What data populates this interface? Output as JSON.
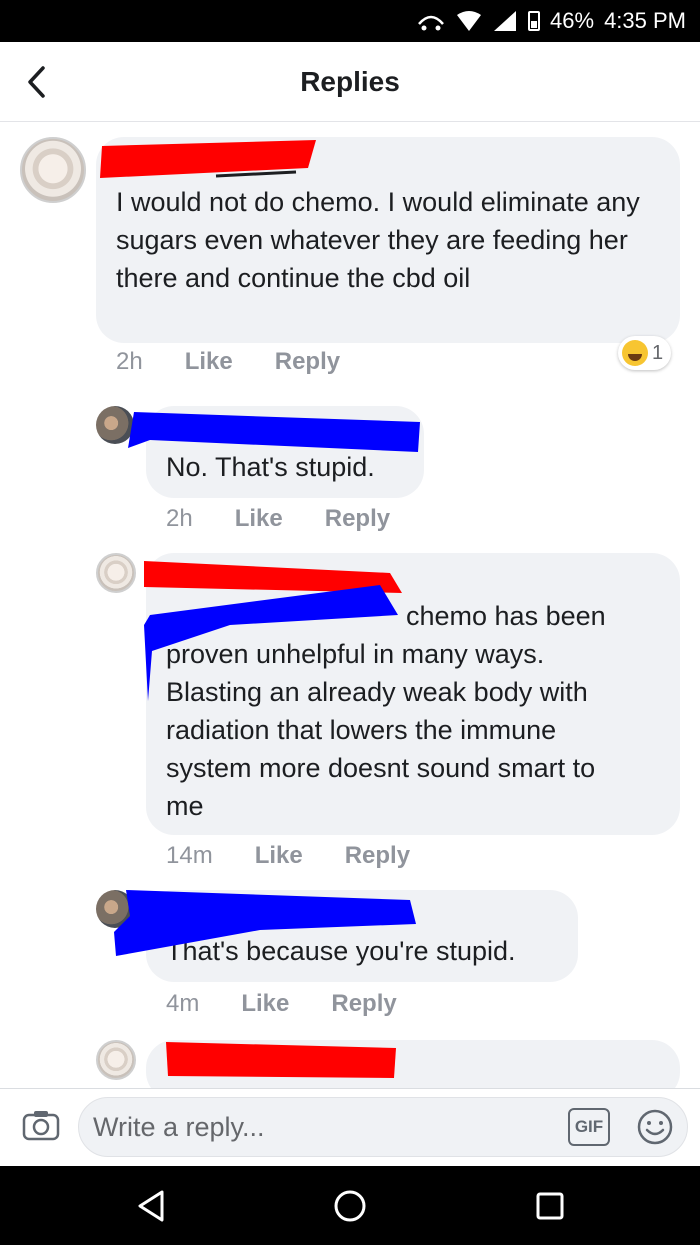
{
  "status_bar": {
    "battery": "46%",
    "time": "4:35 PM",
    "icons": [
      "hotspot-icon",
      "wifi-icon",
      "signal-icon",
      "battery-icon"
    ]
  },
  "header": {
    "title": "Replies",
    "back_icon": "chevron-left-icon"
  },
  "comments": [
    {
      "text": "I would not do chemo. I would eliminate any sugars even whatever they are feeding her there and continue the cbd oil",
      "time": "2h",
      "like_label": "Like",
      "reply_label": "Reply",
      "reaction_count": "1",
      "reaction_icon": "laughing-emoji-icon"
    },
    {
      "text": "No. That's stupid.",
      "time": "2h",
      "like_label": "Like",
      "reply_label": "Reply"
    },
    {
      "text_lines": [
        "chemo has been",
        "proven unhelpful in many ways.",
        "Blasting an already weak body with",
        "radiation that lowers the immune",
        "system more doesnt sound smart to",
        "me"
      ],
      "time": "14m",
      "like_label": "Like",
      "reply_label": "Reply"
    },
    {
      "text": "That's because you're stupid.",
      "time": "4m",
      "like_label": "Like",
      "reply_label": "Reply"
    }
  ],
  "composer": {
    "placeholder": "Write a reply...",
    "camera_icon": "camera-icon",
    "gif_label": "GIF",
    "emoji_icon": "smiley-icon"
  },
  "nav_bar": {
    "icons": [
      "back-triangle-icon",
      "home-circle-icon",
      "recents-square-icon"
    ]
  },
  "colors": {
    "bubble": "#f0f2f5",
    "meta_text": "#90949c",
    "redact_red": "#ff0000",
    "redact_blue": "#0000ff"
  }
}
